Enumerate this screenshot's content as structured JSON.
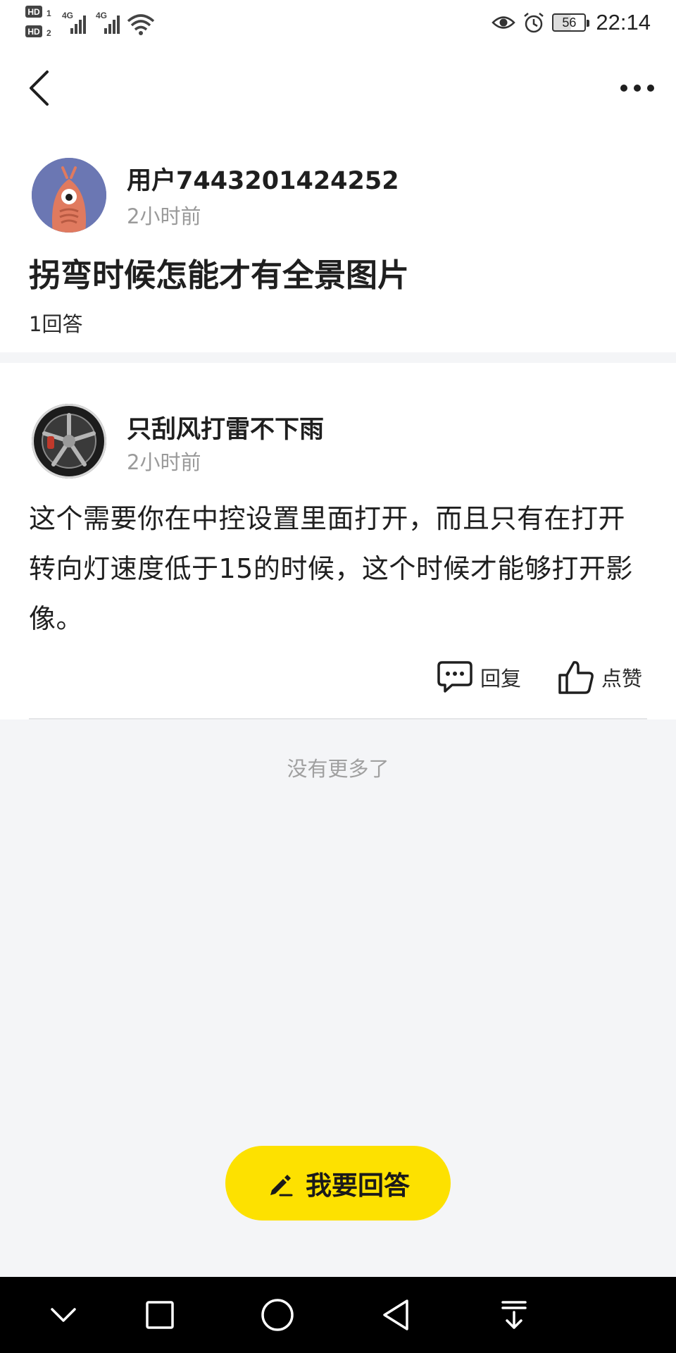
{
  "status_bar": {
    "sim1_label": "HD",
    "sim1_num": "1",
    "sim2_label": "HD",
    "sim2_num": "2",
    "net1": "4G",
    "net2": "4G",
    "battery": "56",
    "time": "22:14"
  },
  "question": {
    "author": "用户7443201424252",
    "time_ago": "2小时前",
    "title": "拐弯时候怎能才有全景图片",
    "answer_count": "1回答"
  },
  "answer": {
    "author": "只刮风打雷不下雨",
    "time_ago": "2小时前",
    "body": "这个需要你在中控设置里面打开，而且只有在打开转向灯速度低于15的时候，这个时候才能够打开影像。",
    "reply_label": "回复",
    "like_label": "点赞"
  },
  "footer": {
    "end_text": "没有更多了",
    "answer_button_label": "我要回答"
  },
  "colors": {
    "accent": "#fde100",
    "background": "#f4f5f7",
    "card": "#ffffff"
  }
}
